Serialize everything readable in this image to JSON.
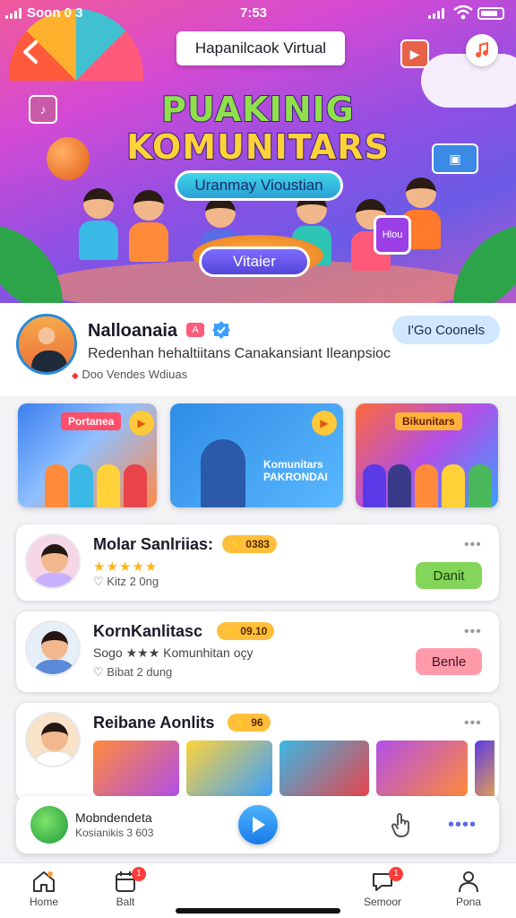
{
  "status_bar": {
    "carrier": "Soon 0 3",
    "time": "7:53"
  },
  "header": {
    "title": "Hapanilcaok Virtual"
  },
  "hero": {
    "headline_1": "PUAKINIG",
    "headline_2": "KOMUNITARS",
    "subtitle": "Uranmay Vioustian",
    "stage_label": "Vitaier",
    "tablet_text": "Hlou"
  },
  "profile": {
    "name": "Nalloanaia",
    "badge_red": "A",
    "description": "Redenhan hehaltiitans Canakansiant Ileanpsioc",
    "meta": "Doo  Vendes Wdiuas",
    "follow_label": "I'Go Coonels"
  },
  "thumbs": [
    {
      "label": "Portanea"
    },
    {
      "label": "Komunitars PAKRONDAI"
    },
    {
      "label": "Bikunitars"
    }
  ],
  "cards": [
    {
      "title": "Molar Sanlriias:",
      "chip": "0383",
      "line2": "★★★★★",
      "line3": "Kitz 2 0ng",
      "button": "Danit"
    },
    {
      "title": "KornKanlitasc",
      "chip": "09.10",
      "line2": "Sogo ★★★ Komunhitan oçy",
      "line3": "Bibat 2 dung",
      "button": "Benle"
    },
    {
      "title": "Reibane Aonlits",
      "chip": "96"
    }
  ],
  "player": {
    "title": "Mobndendeta",
    "subtitle": "Kosianikis 3 603"
  },
  "tabbar": [
    {
      "label": "Home"
    },
    {
      "label": "Balt",
      "badge": "1"
    },
    {
      "label": "Semoor",
      "badge": "1"
    },
    {
      "label": "Pona"
    }
  ],
  "colors": {
    "accent": "#2a8ad9",
    "hero_purple": "#8f4fe3",
    "chip": "#ffbf3a",
    "green_btn": "#84d65a",
    "pink_btn": "#ff9aaa"
  }
}
